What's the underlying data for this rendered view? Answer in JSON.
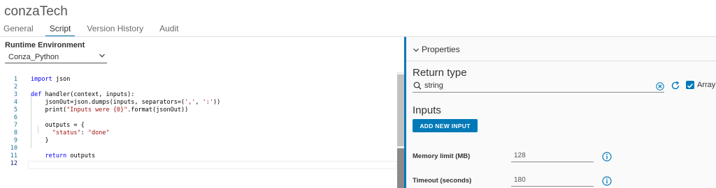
{
  "app": {
    "title": "conzaTech"
  },
  "tabs": [
    {
      "label": "General",
      "active": false
    },
    {
      "label": "Script",
      "active": true
    },
    {
      "label": "Version History",
      "active": false
    },
    {
      "label": "Audit",
      "active": false
    }
  ],
  "runtime": {
    "label": "Runtime Environment",
    "value": "Conza_Python"
  },
  "editor": {
    "line_numbers": [
      "1",
      "2",
      "3",
      "4",
      "5",
      "6",
      "7",
      "8",
      "9",
      "10",
      "11",
      "12"
    ],
    "lines": [
      [
        {
          "t": "import",
          "c": "kw"
        },
        {
          "t": " json",
          "c": ""
        }
      ],
      [],
      [
        {
          "t": "def",
          "c": "kw"
        },
        {
          "t": " handler(context, inputs):",
          "c": ""
        }
      ],
      [
        {
          "t": "    jsonOut=json.dumps(inputs, separators=(",
          "c": ""
        },
        {
          "t": "','",
          "c": "str"
        },
        {
          "t": ", ",
          "c": ""
        },
        {
          "t": "':'",
          "c": "str"
        },
        {
          "t": "))",
          "c": ""
        }
      ],
      [
        {
          "t": "    print(",
          "c": ""
        },
        {
          "t": "\"Inputs were {0}\"",
          "c": "str"
        },
        {
          "t": ".format(jsonOut))",
          "c": ""
        }
      ],
      [],
      [
        {
          "t": "    outputs = {",
          "c": ""
        }
      ],
      [
        {
          "t": "      ",
          "c": ""
        },
        {
          "t": "\"status\"",
          "c": "str"
        },
        {
          "t": ": ",
          "c": ""
        },
        {
          "t": "\"done\"",
          "c": "str"
        }
      ],
      [
        {
          "t": "    }",
          "c": ""
        }
      ],
      [],
      [
        {
          "t": "    ",
          "c": ""
        },
        {
          "t": "return",
          "c": "kw"
        },
        {
          "t": " outputs",
          "c": ""
        }
      ],
      []
    ]
  },
  "properties": {
    "header": "Properties",
    "return_type": {
      "label": "Return type",
      "value": "string",
      "array_label": "Array",
      "array_checked": true
    },
    "inputs": {
      "label": "Inputs",
      "add_button": "ADD NEW INPUT"
    },
    "memory": {
      "label": "Memory limit (MB)",
      "value": "128"
    },
    "timeout": {
      "label": "Timeout (seconds)",
      "value": "180"
    }
  },
  "colors": {
    "accent": "#0079b8",
    "keyword": "#0000ff",
    "string": "#a31515",
    "line_number": "#237893"
  }
}
